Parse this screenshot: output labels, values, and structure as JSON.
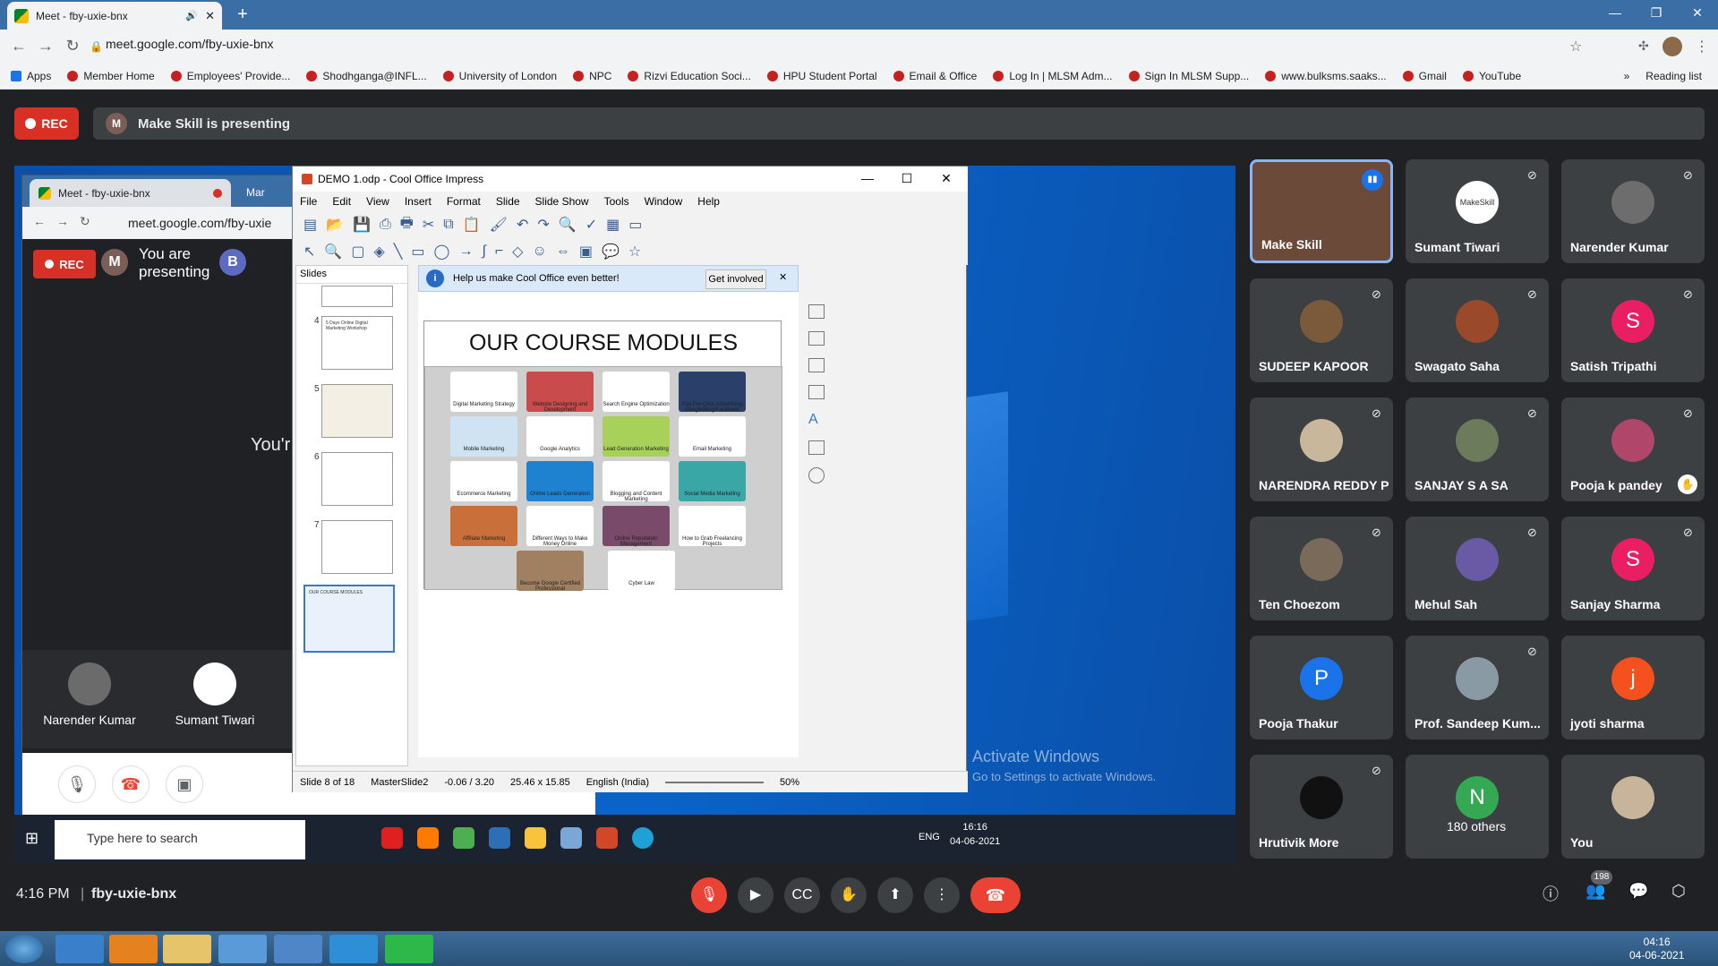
{
  "browser": {
    "tab_title": "Meet - fby-uxie-bnx",
    "url": "meet.google.com/fby-uxie-bnx",
    "bookmarks": [
      "Apps",
      "Member Home",
      "Employees' Provide...",
      "Shodhganga@INFL...",
      "University of London",
      "NPC",
      "Rizvi Education Soci...",
      "HPU Student Portal",
      "Email & Office",
      "Log In | MLSM Adm...",
      "Sign In MLSM Supp...",
      "www.bulksms.saaks...",
      "Gmail",
      "YouTube"
    ],
    "reading_list": "Reading list",
    "more": "»"
  },
  "meet": {
    "rec_label": "REC",
    "presenter_initial": "M",
    "presenting_text": "Make Skill is presenting",
    "time": "4:16 PM",
    "sep": "|",
    "code": "fby-uxie-bnx",
    "people_count": "198"
  },
  "inner_meet": {
    "tab_title": "Meet - fby-uxie-bnx",
    "tab2": "Mar",
    "url": "meet.google.com/fby-uxie",
    "rec_label": "REC",
    "avatar_m": "M",
    "presenting_line1": "You are",
    "presenting_line2": "presenting",
    "avatar_b": "B",
    "youre_text": "You'r",
    "participants": [
      "Narender Kumar",
      "Sumant Tiwari"
    ]
  },
  "impress": {
    "title": "DEMO 1.odp - Cool Office Impress",
    "menu": [
      "File",
      "Edit",
      "View",
      "Insert",
      "Format",
      "Slide",
      "Slide Show",
      "Tools",
      "Window",
      "Help"
    ],
    "slides_panel_title": "Slides",
    "slide_numbers": [
      "4",
      "5",
      "6",
      "7",
      "8"
    ],
    "thumb4_text": "5 Days Online Digital Marketing Workshop",
    "thumb8_text": "OUR COURSE MODULES",
    "infobar_text": "Help us make Cool Office even better!",
    "get_involved": "Get involved",
    "slide_title": "OUR COURSE MODULES",
    "modules": [
      "Digital Marketing Strategy",
      "Website Designing and Development",
      "Search Engine Optimization",
      "Pay Per Click Advertising Google/Bing/Facebook",
      "Mobile Marketing",
      "Google Analytics",
      "Lead Generation Marketing",
      "Email Marketing",
      "Ecommerce Marketing",
      "Online Leads Generation",
      "Blogging and Content Marketing",
      "Social Media Marketing",
      "Affiliate Marketing",
      "Different Ways to Make Money Online",
      "Online Reputation Management",
      "How to Grab Freelancing Projects",
      "Become Google Certified Professional",
      "Cyber Law"
    ],
    "status": {
      "slide": "Slide 8 of 18",
      "master": "MasterSlide2",
      "pos": "-0.06 / 3.20",
      "size": "25.46 x 15.85",
      "lang": "English (India)",
      "zoom": "50%"
    }
  },
  "desktop": {
    "activate_title": "Activate Windows",
    "activate_sub": "Go to Settings to activate Windows.",
    "search_placeholder": "Type here to search",
    "lang": "ENG",
    "time": "16:16",
    "date": "04-06-2021"
  },
  "participants": [
    {
      "name": "Make Skill"
    },
    {
      "name": "Sumant Tiwari",
      "initial": "MakeSkill",
      "color": "#ffffff"
    },
    {
      "name": "Narender Kumar",
      "color": "#6d6d6d"
    },
    {
      "name": "SUDEEP KAPOOR",
      "color": "#7a5a3a"
    },
    {
      "name": "Swagato Saha",
      "color": "#9a4a2a"
    },
    {
      "name": "Satish Tripathi",
      "initial": "S",
      "color": "#e91e63"
    },
    {
      "name": "NARENDRA REDDY P",
      "color": "#c9b79c"
    },
    {
      "name": "SANJAY S A SA",
      "color": "#6b7b5b"
    },
    {
      "name": "Pooja k pandey",
      "color": "#b0466a"
    },
    {
      "name": "Ten Choezom",
      "color": "#7a6a5a"
    },
    {
      "name": "Mehul Sah",
      "color": "#6a5aa5"
    },
    {
      "name": "Sanjay Sharma",
      "initial": "S",
      "color": "#e91e63"
    },
    {
      "name": "Pooja Thakur",
      "initial": "P",
      "color": "#1a73e8"
    },
    {
      "name": "Prof. Sandeep Kum...",
      "color": "#8a9aa5"
    },
    {
      "name": "jyoti sharma",
      "initial": "j",
      "color": "#f4511e"
    },
    {
      "name": "Hrutivik More",
      "color": "#111111"
    },
    {
      "name": "180 others",
      "initial": "N",
      "color": "#34a853"
    },
    {
      "name": "You",
      "color": "#c8b49a"
    }
  ],
  "system": {
    "time": "04:16",
    "date": "04-06-2021"
  },
  "colors": {
    "rec": "#d93025",
    "end_call": "#ea4335",
    "accent": "#8ab4f8"
  }
}
